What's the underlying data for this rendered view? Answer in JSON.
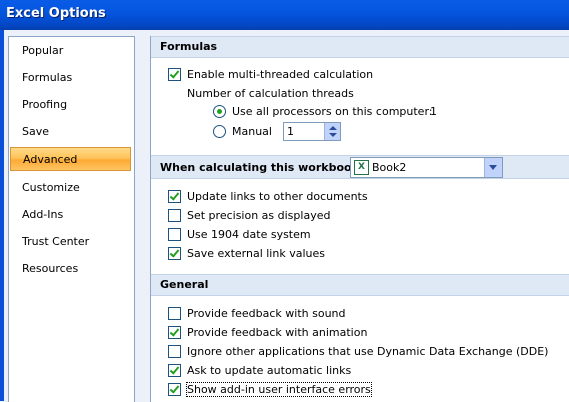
{
  "window": {
    "title": "Excel Options"
  },
  "sidebar": {
    "items": [
      {
        "label": "Popular"
      },
      {
        "label": "Formulas"
      },
      {
        "label": "Proofing"
      },
      {
        "label": "Save"
      },
      {
        "label": "Advanced",
        "selected": true
      },
      {
        "label": "Customize"
      },
      {
        "label": "Add-Ins"
      },
      {
        "label": "Trust Center"
      },
      {
        "label": "Resources"
      }
    ]
  },
  "formulas": {
    "title": "Formulas",
    "multithread_label": "Enable multi-threaded calculation",
    "multithread_checked": true,
    "threads_label": "Number of calculation threads",
    "all_processors_label": "Use all processors on this computer:",
    "all_processors_value": "1",
    "manual_label": "Manual",
    "manual_value": "1"
  },
  "workbook": {
    "title": "When calculating this workbook:",
    "selected_workbook": "Book2",
    "options": [
      {
        "label": "Update links to other documents",
        "checked": true
      },
      {
        "label": "Set precision as displayed",
        "checked": false
      },
      {
        "label": "Use 1904 date system",
        "checked": false
      },
      {
        "label": "Save external link values",
        "checked": true
      }
    ]
  },
  "general": {
    "title": "General",
    "options": [
      {
        "label": "Provide feedback with sound",
        "checked": false
      },
      {
        "label": "Provide feedback with animation",
        "checked": true
      },
      {
        "label": "Ignore other applications that use Dynamic Data Exchange (DDE)",
        "checked": false
      },
      {
        "label": "Ask to update automatic links",
        "checked": true
      },
      {
        "label": "Show add-in user interface errors",
        "checked": true
      }
    ]
  },
  "colors": {
    "title_bar": "#0556df",
    "section_bg": "#dfe8f5",
    "selected_nav": "#ffc45a",
    "check_green": "#21a121"
  }
}
